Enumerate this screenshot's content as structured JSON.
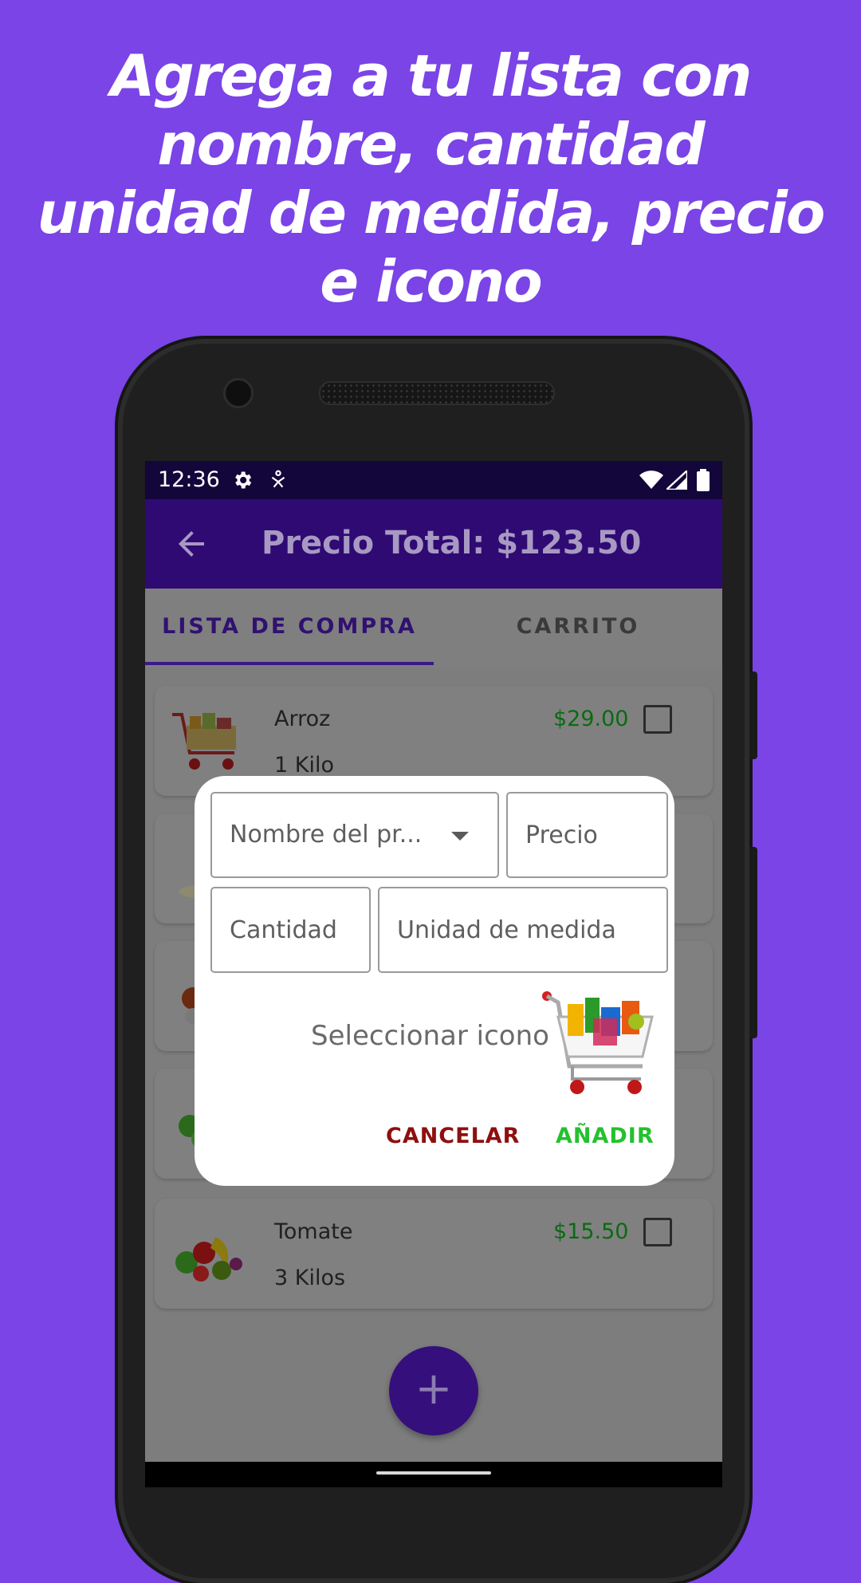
{
  "headline": {
    "lines": [
      "Agrega a tu lista con",
      "nombre, cantidad",
      "unidad de medida, precio",
      "e icono"
    ]
  },
  "status_bar": {
    "time": "12:36"
  },
  "app_bar": {
    "title": "Precio Total: $123.50"
  },
  "tabs": [
    {
      "label": "LISTA DE COMPRA",
      "active": true
    },
    {
      "label": "CARRITO",
      "active": false
    }
  ],
  "items": [
    {
      "name": "Arroz",
      "quantity": "1 Kilo",
      "price": "$29.00",
      "checked": false
    },
    {
      "name": "Tomate",
      "quantity": "3 Kilos",
      "price": "$15.50",
      "checked": false
    }
  ],
  "dialog": {
    "product_name_placeholder": "Nombre del pr...",
    "price_placeholder": "Precio",
    "quantity_placeholder": "Cantidad",
    "unit_placeholder": "Unidad de medida",
    "select_icon_label": "Seleccionar icono",
    "cancel_label": "CANCELAR",
    "add_label": "AÑADIR"
  },
  "fab": {
    "label": "+"
  },
  "colors": {
    "background": "#7a44e6",
    "app_bar": "#2f0a73",
    "accent": "#3a1a8a",
    "price_green": "#0b6a12",
    "cancel_red": "#8f0f0f",
    "add_green": "#24c12e"
  }
}
